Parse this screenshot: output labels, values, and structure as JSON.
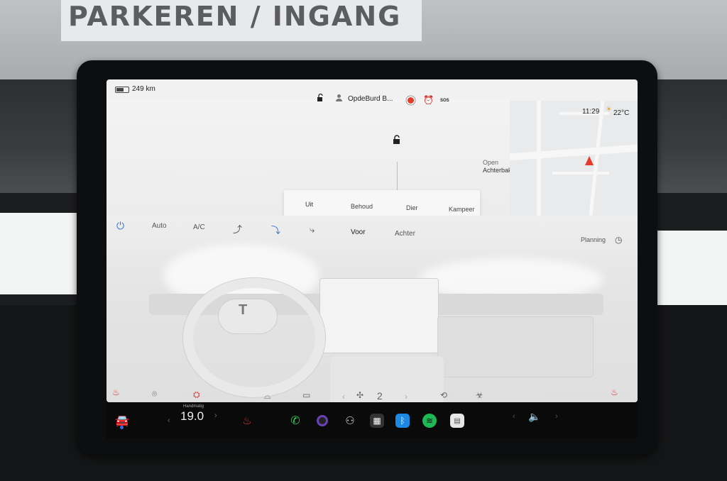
{
  "scene": {
    "sign_text": "PARKEREN / INGANG"
  },
  "status": {
    "range": "249 km",
    "profile_name": "OpdeBurd B...",
    "sos": "SOS",
    "time": "11:29",
    "temperature": "22°C"
  },
  "car": {
    "trunk_label_1": "Open",
    "trunk_label_2": "Achterbak"
  },
  "mode_popup": {
    "options": [
      "Uit",
      "Behoud",
      "Dier",
      "Kampeer"
    ]
  },
  "climate": {
    "auto": "Auto",
    "ac": "A/C",
    "front": "Voor",
    "rear": "Achter",
    "planning": "Planning",
    "fan_speed": "2"
  },
  "dock": {
    "temp_mode": "Handmatig",
    "temperature": "19.0"
  },
  "colors": {
    "accent_blue": "#2f6fe0",
    "seat_heat_red": "#d9342b",
    "nav_red": "#e43b2c",
    "phone_green": "#34c759",
    "spotify_green": "#1db954",
    "bluetooth_blue": "#1e88e5"
  }
}
